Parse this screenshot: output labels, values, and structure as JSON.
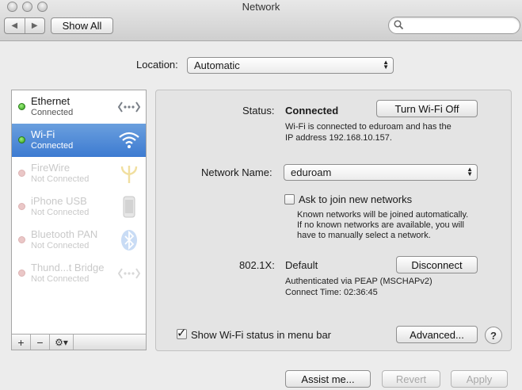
{
  "window": {
    "title": "Network"
  },
  "toolbar": {
    "show_all_label": "Show All",
    "search_placeholder": ""
  },
  "location": {
    "label": "Location:",
    "value": "Automatic"
  },
  "services": [
    {
      "name": "Ethernet",
      "status": "Connected",
      "state": "connected",
      "icon": "ethernet-icon"
    },
    {
      "name": "Wi-Fi",
      "status": "Connected",
      "state": "connected",
      "icon": "wifi-icon",
      "selected": true
    },
    {
      "name": "FireWire",
      "status": "Not Connected",
      "state": "not-connected",
      "icon": "firewire-icon"
    },
    {
      "name": "iPhone USB",
      "status": "Not Connected",
      "state": "not-connected",
      "icon": "iphone-icon"
    },
    {
      "name": "Bluetooth PAN",
      "status": "Not Connected",
      "state": "not-connected",
      "icon": "bluetooth-icon"
    },
    {
      "name": "Thund...t Bridge",
      "status": "Not Connected",
      "state": "not-connected",
      "icon": "thunderbolt-bridge-icon"
    }
  ],
  "sidebar_controls": {
    "add": "+",
    "remove": "−",
    "gear": "⚙▾"
  },
  "detail": {
    "status_label": "Status:",
    "status_value": "Connected",
    "turn_off_label": "Turn Wi-Fi Off",
    "status_desc_line1": "Wi-Fi is connected to eduroam and has the",
    "status_desc_line2": "IP address 192.168.10.157.",
    "network_name_label": "Network Name:",
    "network_name_value": "eduroam",
    "ask_join_label": "Ask to join new networks",
    "ask_join_checked": false,
    "ask_join_desc_line1": "Known networks will be joined automatically.",
    "ask_join_desc_line2": "If no known networks are available, you will",
    "ask_join_desc_line3": "have to manually select a network.",
    "x8021_label": "802.1X:",
    "x8021_value": "Default",
    "disconnect_label": "Disconnect",
    "auth_line1": "Authenticated via PEAP (MSCHAPv2)",
    "auth_line2": "Connect Time: 02:36:45",
    "show_status_label": "Show Wi-Fi status in menu bar",
    "show_status_checked": true,
    "advanced_label": "Advanced...",
    "help_label": "?"
  },
  "footer": {
    "assist_label": "Assist me...",
    "revert_label": "Revert",
    "apply_label": "Apply"
  },
  "colors": {
    "selection": "#3d7bd1",
    "connected": "#2d9d16",
    "not_connected": "#eac7c7"
  }
}
